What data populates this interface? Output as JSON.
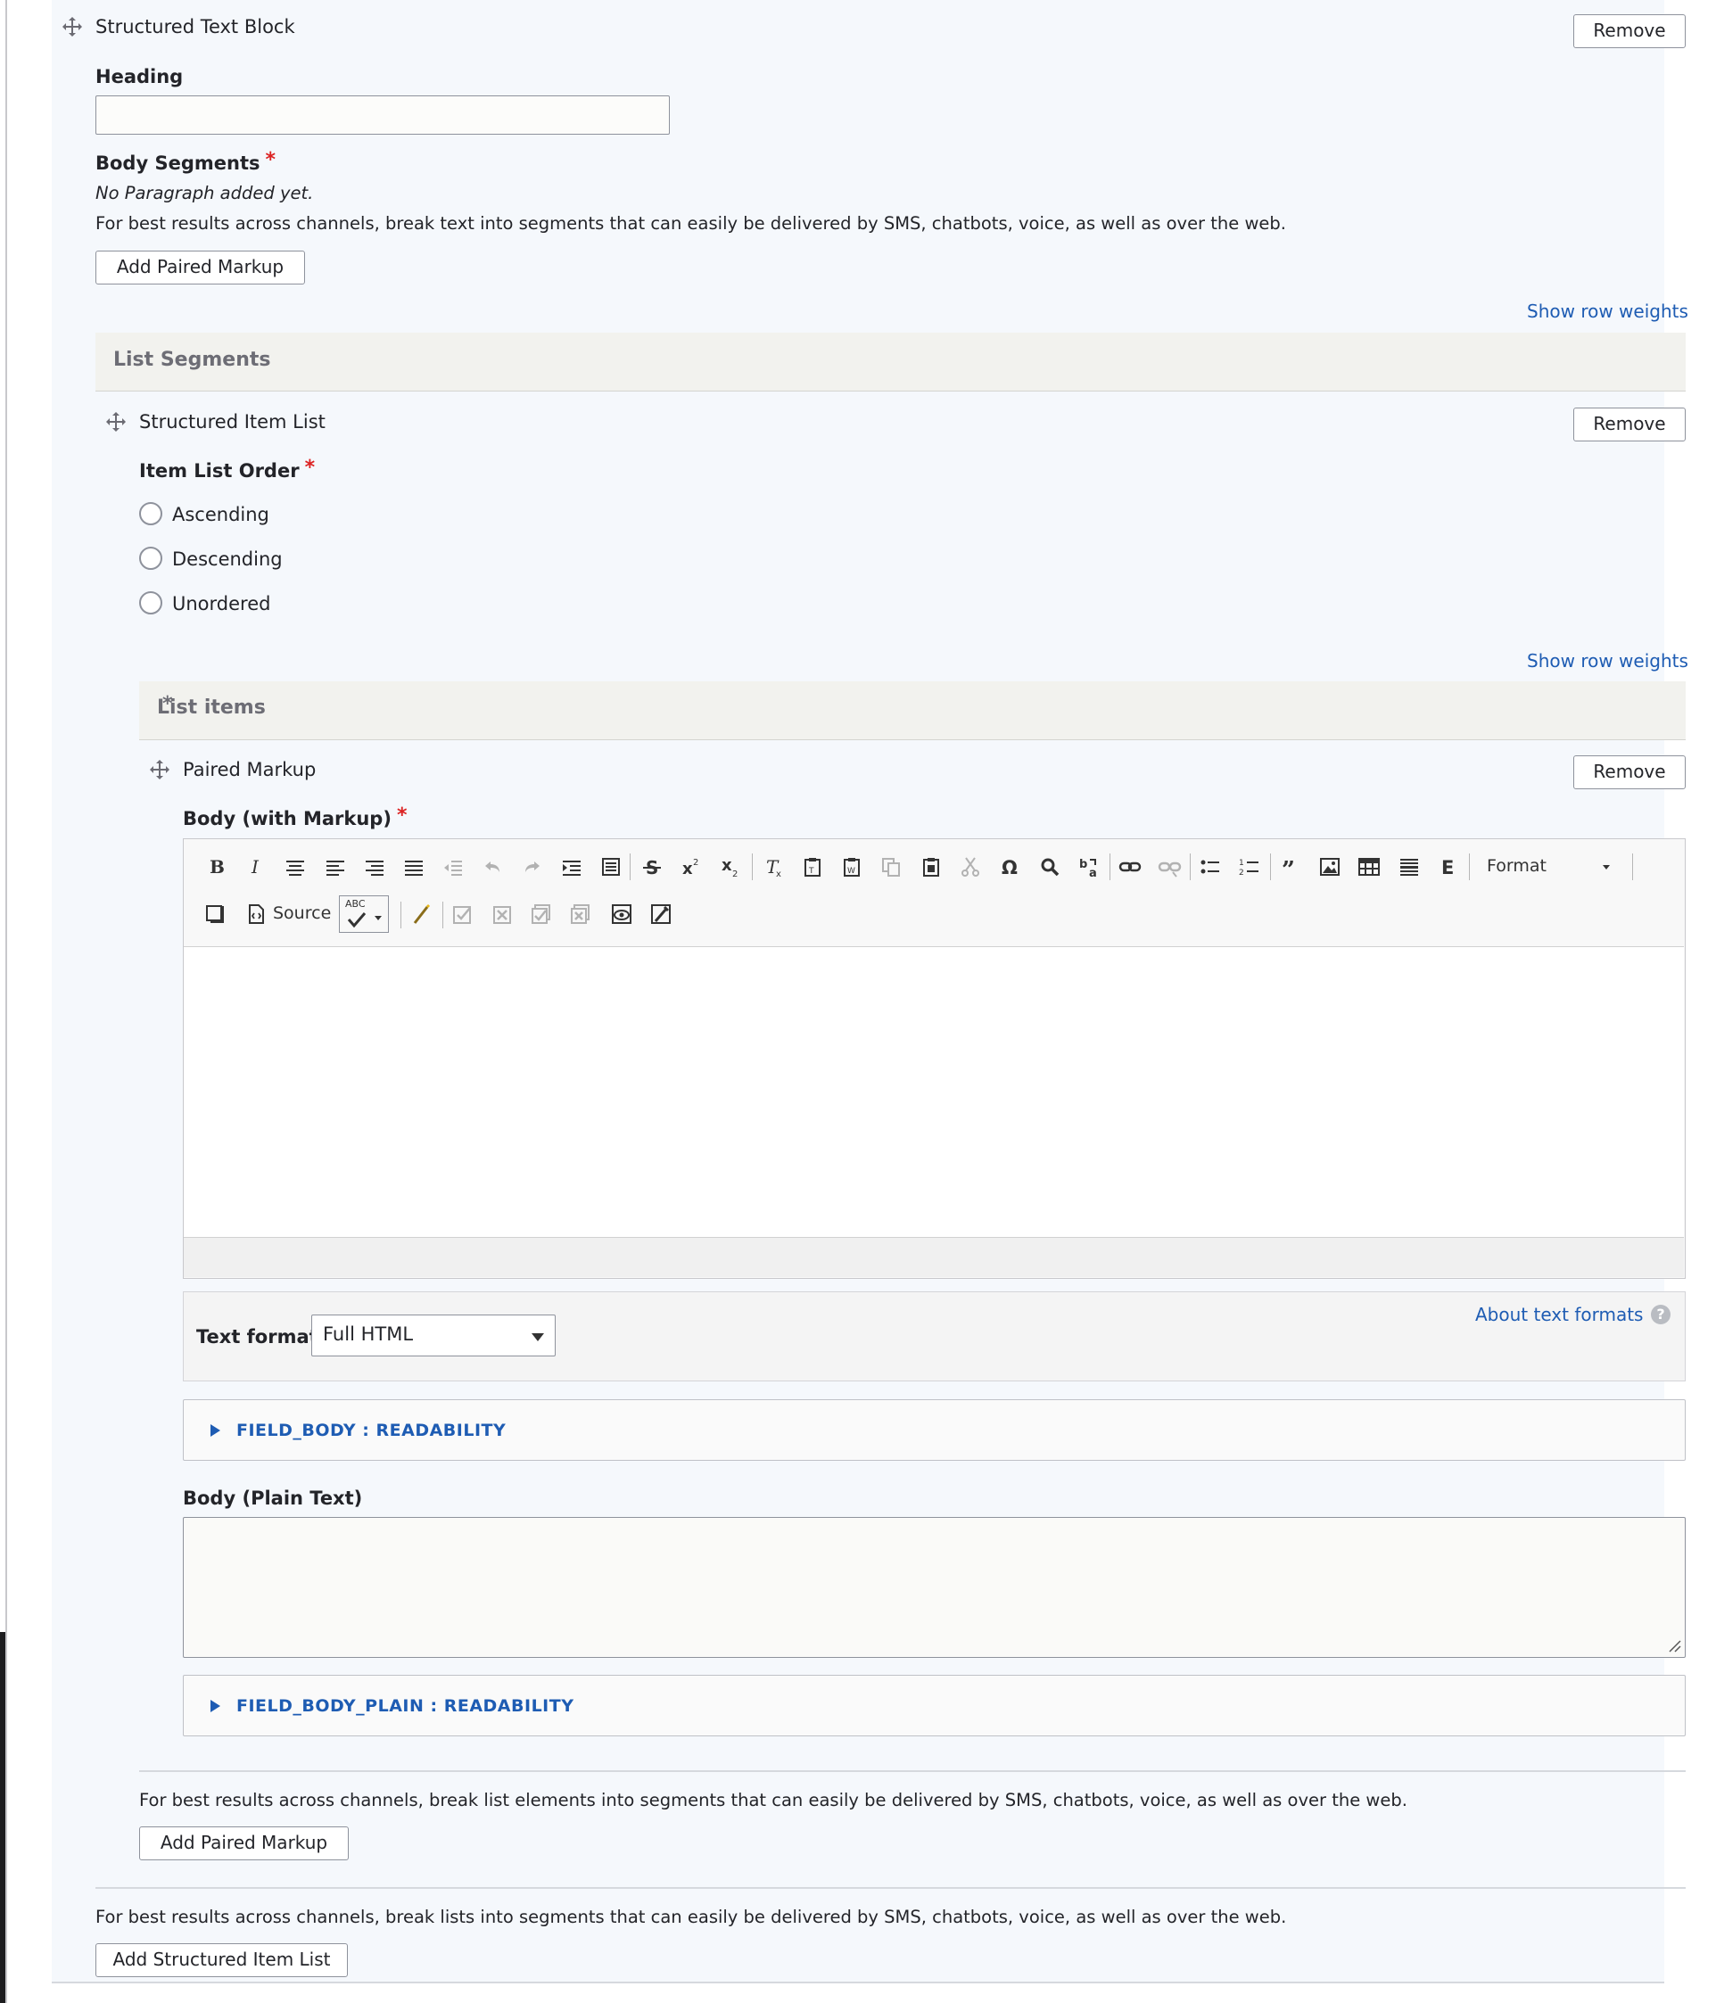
{
  "structured_text_block": {
    "title": "Structured Text Block",
    "remove_label": "Remove",
    "heading_label": "Heading",
    "heading_value": "",
    "body_segments_label": "Body Segments",
    "required_mark": "*",
    "no_paragraph": "No Paragraph added yet.",
    "body_segments_desc": "For best results across channels, break text into segments that can easily be delivered by SMS, chatbots, voice, as well as over the web.",
    "add_paired_markup": "Add Paired Markup"
  },
  "show_row_weights": "Show row weights",
  "list_segments": {
    "header": "List Segments",
    "item_list": {
      "title": "Structured Item List",
      "remove_label": "Remove",
      "order_label": "Item List Order",
      "order_options": [
        "Ascending",
        "Descending",
        "Unordered"
      ],
      "list_items_header": "List items",
      "paired_markup": {
        "title": "Paired Markup",
        "remove_label": "Remove",
        "body_markup_label": "Body (with Markup)",
        "toolbar": {
          "format_label": "Format",
          "source_label": "Source",
          "spell_label": "ABC",
          "icons": [
            "bold-icon",
            "italic-icon",
            "align-center-icon",
            "align-left-icon",
            "align-right-icon",
            "align-justify-icon",
            "outdent-icon",
            "undo-icon",
            "redo-icon",
            "indent-icon",
            "div-icon",
            "strikethrough-icon",
            "superscript-icon",
            "subscript-icon",
            "remove-format-icon",
            "paste-text-icon",
            "paste-word-icon",
            "copy-icon",
            "paste-icon",
            "cut-icon",
            "omega-icon",
            "find-icon",
            "replace-icon",
            "link-icon",
            "unlink-icon",
            "bulleted-list-icon",
            "numbered-list-icon",
            "blockquote-icon",
            "image-icon",
            "table-icon",
            "horizontal-rule-icon",
            "embed-icon"
          ]
        },
        "text_format_label": "Text format",
        "text_format_value": "Full HTML",
        "about_text_formats": "About text formats",
        "help_glyph": "?",
        "field_body_readability": "FIELD_BODY : READABILITY",
        "body_plain_label": "Body (Plain Text)",
        "body_plain_value": "",
        "field_body_plain_readability": "FIELD_BODY_PLAIN : READABILITY"
      },
      "list_items_desc": "For best results across channels, break list elements into segments that can easily be delivered by SMS, chatbots, voice, as well as over the web.",
      "add_paired_markup": "Add Paired Markup"
    },
    "lists_desc": "For best results across channels, break lists into segments that can easily be delivered by SMS, chatbots, voice, as well as over the web.",
    "add_structured_item_list": "Add Structured Item List"
  },
  "colors": {
    "panel_bg": "#f5f8fc",
    "link": "#1e5cb3",
    "required": "#dc2323",
    "table_header_bg": "#f2f2ee"
  }
}
